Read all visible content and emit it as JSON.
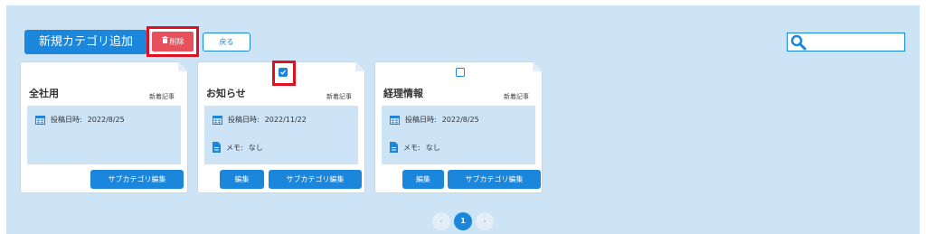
{
  "toolbar": {
    "add_label": "新規カテゴリ追加",
    "delete_label": "削除",
    "back_label": "戻る",
    "search_value": ""
  },
  "cards": [
    {
      "title": "全社用",
      "tag": "新着記事",
      "date_label": "投稿日時:",
      "date": "2022/8/25",
      "memo_label": "",
      "memo": "",
      "edit_label": "",
      "sub_label": "サブカテゴリ編集",
      "checked": false
    },
    {
      "title": "お知らせ",
      "tag": "新着記事",
      "date_label": "投稿日時:",
      "date": "2022/11/22",
      "memo_label": "メモ:",
      "memo": "なし",
      "edit_label": "編集",
      "sub_label": "サブカテゴリ編集",
      "checked": true
    },
    {
      "title": "経理情報",
      "tag": "新着記事",
      "date_label": "投稿日時:",
      "date": "2022/8/25",
      "memo_label": "メモ:",
      "memo": "なし",
      "edit_label": "編集",
      "sub_label": "サブカテゴリ編集",
      "checked": false
    }
  ],
  "pagination": {
    "prev": "‹",
    "current": "1",
    "next": "›"
  },
  "colors": {
    "accent": "#1a86dc",
    "danger": "#e8505b",
    "panel": "#cde4f7",
    "highlight": "#e01020"
  },
  "icons": [
    "trash-icon",
    "search-icon",
    "calendar-icon",
    "document-icon",
    "checkmark-icon"
  ]
}
